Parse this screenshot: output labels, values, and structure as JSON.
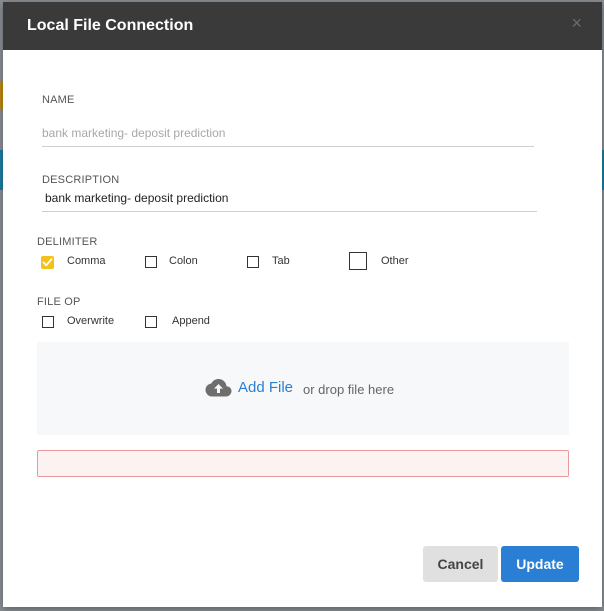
{
  "dialog": {
    "title": "Local File Connection",
    "close_glyph": "×"
  },
  "form": {
    "name_label": "NAME",
    "name_placeholder": "bank marketing- deposit prediction",
    "name_value": "",
    "description_label": "DESCRIPTION",
    "description_value": "bank marketing- deposit prediction"
  },
  "delimiter": {
    "label": "DELIMITER",
    "options": [
      {
        "label": "Comma",
        "checked": true
      },
      {
        "label": "Colon",
        "checked": false
      },
      {
        "label": "Tab",
        "checked": false
      },
      {
        "label": "Other",
        "checked": false
      }
    ]
  },
  "file_op": {
    "label": "FILE OP",
    "options": [
      {
        "label": "Overwrite",
        "checked": false
      },
      {
        "label": "Append",
        "checked": false
      }
    ]
  },
  "dropzone": {
    "icon": "cloud-upload-icon",
    "add_label": "Add File",
    "or_label": "or drop file here"
  },
  "buttons": {
    "cancel": "Cancel",
    "update": "Update"
  },
  "colors": {
    "accent": "#2a7fd4",
    "checked": "#f2c21b",
    "titlebar": "#3a3a3a",
    "error_border": "#e89a9a"
  }
}
